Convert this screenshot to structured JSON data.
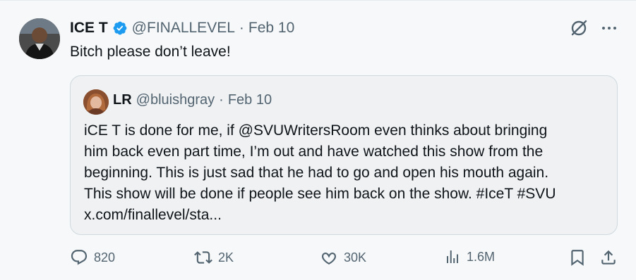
{
  "tweet": {
    "display_name": "ICE T",
    "handle": "@FINALLEVEL",
    "separator": "·",
    "date": "Feb 10",
    "text": "Bitch please don’t leave!",
    "avatar_icon": "avatar-photo-icon",
    "verified_icon": "verified-badge-icon",
    "verified_color": "#1d9bf0"
  },
  "quoted": {
    "display_name": "LR",
    "handle": "@bluishgray",
    "separator": "·",
    "date": "Feb 10",
    "lines": [
      "iCE T is done for me, if @SVUWritersRoom even thinks about bringing",
      "him back even part time, I’m out and have watched this show from the",
      "beginning. This is just sad that he had to go and open his mouth again.",
      "This show will be done if people see him back on the show. #IceT #SVU",
      "x.com/finallevel/sta..."
    ]
  },
  "actions": {
    "replies": "820",
    "retweets": "2K",
    "likes": "30K",
    "views": "1.6M"
  },
  "colors": {
    "text_primary": "#0f1419",
    "text_secondary": "#536471",
    "border": "#cfd9de"
  }
}
